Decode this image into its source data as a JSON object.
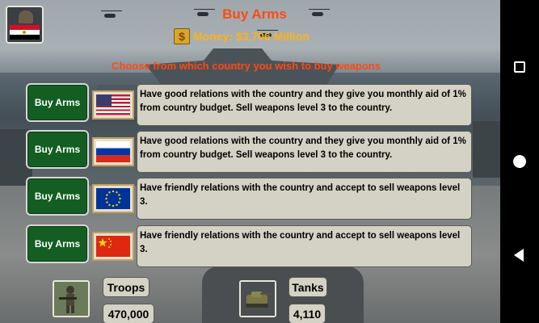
{
  "screen": {
    "title": "Buy Arms",
    "money": "Money: $3,706 Million",
    "money_icon": "dollar-coin-icon",
    "subtitle": "Choose from which country you wish to buy weapons",
    "player_flag": "egypt-flag-icon"
  },
  "offers": [
    {
      "button": "Buy Arms",
      "flag": "usa-flag-icon",
      "description": "Have good relations with the country and they give you monthly aid of 1% from country budget. Sell weapons level 3 to the country."
    },
    {
      "button": "Buy Arms",
      "flag": "russia-flag-icon",
      "description": "Have good relations with the country and they give you monthly aid of 1% from country budget. Sell weapons level 3 to the country."
    },
    {
      "button": "Buy Arms",
      "flag": "eu-flag-icon",
      "description": "Have friendly relations with the country and accept to sell weapons level 3."
    },
    {
      "button": "Buy Arms",
      "flag": "china-flag-icon",
      "description": "Have friendly relations with the country and accept to sell weapons level 3."
    }
  ],
  "stats": {
    "troops": {
      "label": "Troops",
      "value": "470,000",
      "icon": "soldier-icon"
    },
    "tanks": {
      "label": "Tanks",
      "value": "4,110",
      "icon": "tank-icon"
    }
  },
  "navbar": {
    "buttons": [
      "recents-square-icon",
      "home-circle-icon",
      "back-triangle-icon"
    ]
  },
  "colors": {
    "title": "#ff4a12",
    "money": "#ffb21a",
    "button": "#145e23",
    "panel": "#d4d2c4"
  }
}
